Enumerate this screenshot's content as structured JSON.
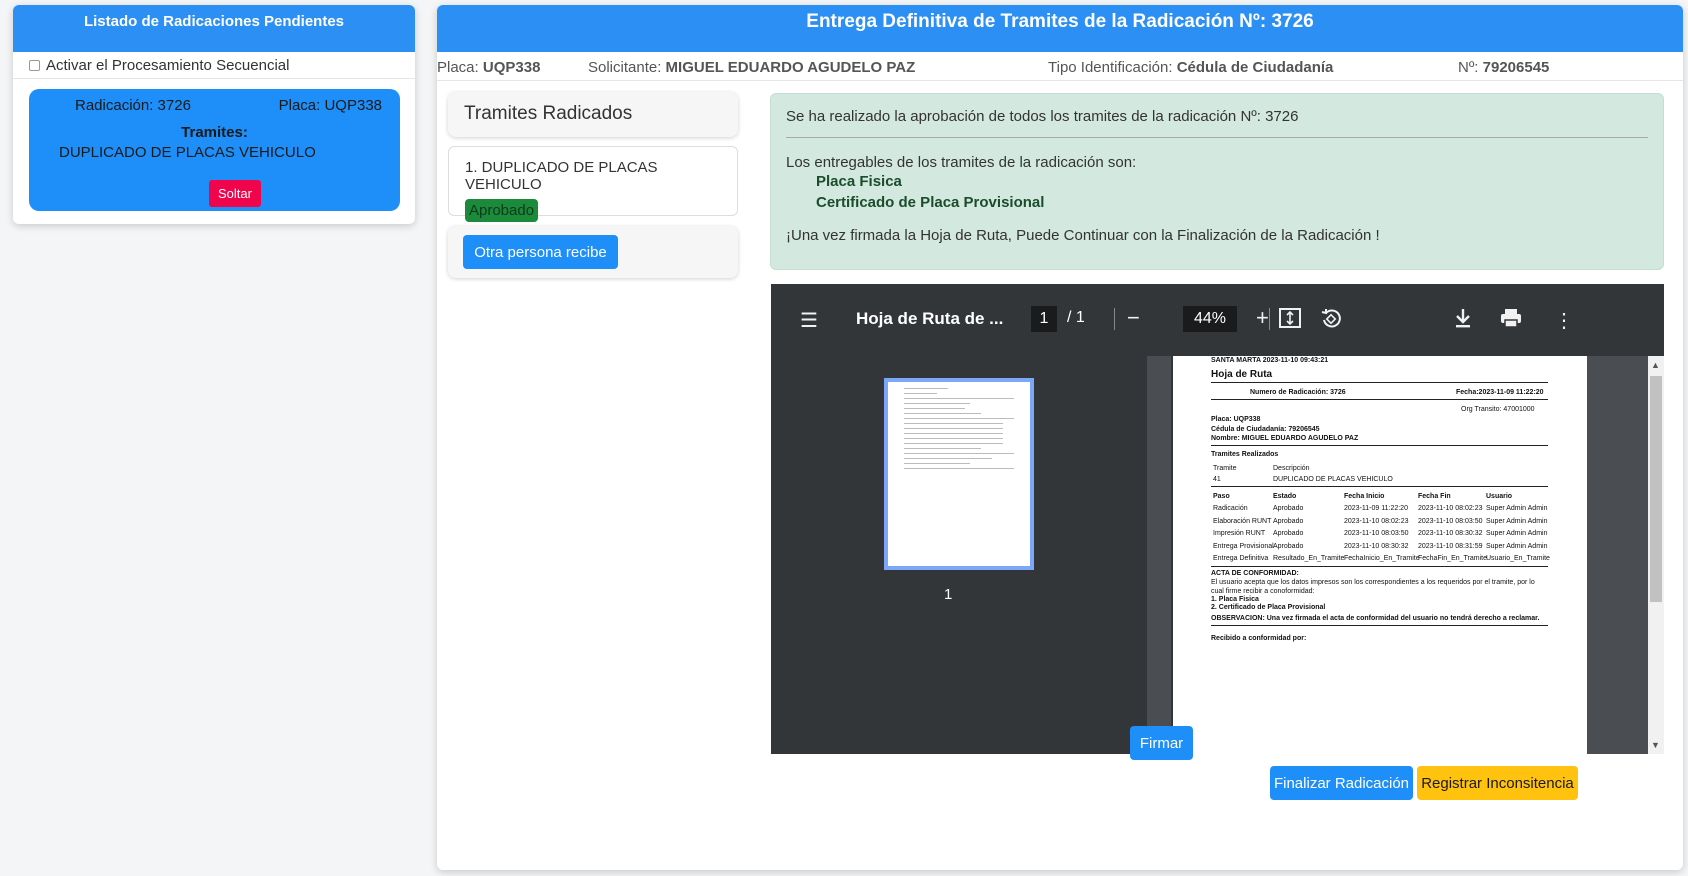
{
  "left": {
    "title": "Listado de Radicaciones Pendientes",
    "sequential_label": "Activar el Procesamiento Secuencial",
    "card": {
      "radicacion": "Radicación: 3726",
      "placa": "Placa: UQP338",
      "tramites_label": "Tramites:",
      "tramite": "DUPLICADO DE PLACAS VEHICULO",
      "soltar_label": "Soltar"
    }
  },
  "main": {
    "title": "Entrega Definitiva de Tramites de la Radicación Nº: 3726",
    "info": {
      "placa_k": "Placa:",
      "placa_v": "UQP338",
      "solicitante_k": "Solicitante:",
      "solicitante_v": "MIGUEL EDUARDO AGUDELO PAZ",
      "tipo_k": "Tipo Identificación:",
      "tipo_v": "Cédula de Ciudadanía",
      "num_k": "Nº:",
      "num_v": "79206545"
    },
    "tramites_title": "Tramites Radicados",
    "tramite_item": "1. DUPLICADO DE PLACAS VEHICULO",
    "tramite_status": "Aprobado",
    "otra_persona_label": "Otra persona recibe",
    "alert": {
      "line1": "Se ha realizado la aprobación de todos los tramites de la radicación Nº: 3726",
      "line2": "Los entregables de los tramites de la radicación son:",
      "deliverable1": "Placa Fisica",
      "deliverable2": "Certificado de Placa Provisional",
      "line3": "¡Una vez firmada la Hoja de Ruta, Puede Continuar con la Finalización de la Radicación !"
    },
    "pdf": {
      "title": "Hoja de Ruta de ...",
      "page_current": "1",
      "page_total": "/  1",
      "zoom": "44%",
      "thumb_num": "1",
      "doc": {
        "header": "SANTA MARTA 2023-11-10 09:43:21",
        "title": "Hoja de Ruta",
        "num_rad": "Numero de Radicación: 3726",
        "fecha": "Fecha:2023-11-09 11:22:20",
        "org": "Org Transito: 47001000",
        "placa": "Placa: UQP338",
        "cedula": "Cédula de Ciudadanía: 79206545",
        "nombre": "Nombre: MIGUEL EDUARDO AGUDELO PAZ",
        "tramites_realizados": "Tramites Realizados",
        "th_tramite": "Tramite",
        "th_desc": "Descripción",
        "tr_code": "41",
        "tr_desc": "DUPLICADO DE PLACAS VEHICULO",
        "cols": [
          "Paso",
          "Estado",
          "Fecha Inicio",
          "Fecha Fin",
          "Usuario"
        ],
        "rows": [
          [
            "Radicación",
            "Aprobado",
            "2023-11-09 11:22:20",
            "2023-11-10 08:02:23",
            "Super Admin Admin"
          ],
          [
            "Elaboración RUNT",
            "Aprobado",
            "2023-11-10 08:02:23",
            "2023-11-10 08:03:50",
            "Super Admin Admin"
          ],
          [
            "Impresión RUNT",
            "Aprobado",
            "2023-11-10 08:03:50",
            "2023-11-10 08:30:32",
            "Super Admin Admin"
          ],
          [
            "Entrega Provisional",
            "Aprobado",
            "2023-11-10 08:30:32",
            "2023-11-10 08:31:59",
            "Super Admin Admin"
          ],
          [
            "Entrega Definitiva",
            "Resultado_En_Tramite",
            "FechaInicio_En_Tramite",
            "FechaFin_En_Tramite",
            "Usuario_En_Tramite"
          ]
        ],
        "acta": "ACTA DE CONFORMIDAD:",
        "acta1": "El usuario acepta que los datos impresos son los correspondientes a los requeridos por el tramite, por lo",
        "acta2": "cual firme recibir a conoformidad:",
        "acta3": "1. Placa Fisica",
        "acta4": "2. Certificado de Placa Provisional",
        "obs": "OBSERVACION: Una vez firmada el acta de conformidad del usuario no tendrá derecho a reclamar.",
        "recibido": "Recibido a conformidad por:"
      }
    },
    "firmar_label": "Firmar",
    "finalizar_label": "Finalizar Radicación",
    "registrar_label": "Registrar Inconsitencia"
  }
}
